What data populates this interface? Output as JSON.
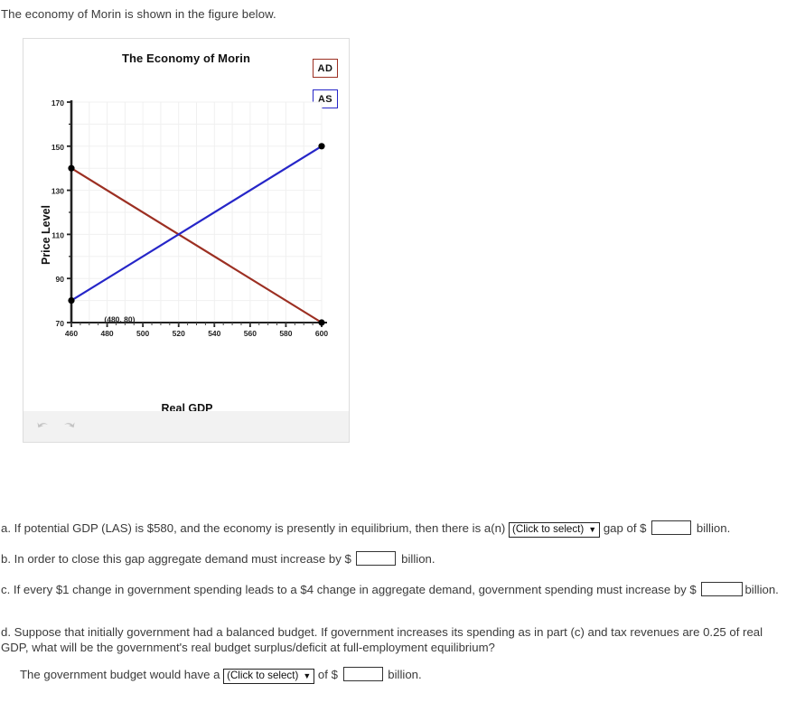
{
  "intro": "The economy of Morin is shown in the figure below.",
  "figure": {
    "legend": [
      {
        "label": "AD",
        "color": "#9c2f22"
      },
      {
        "label": "AS",
        "color": "#2626c8"
      }
    ],
    "toolbar": {
      "undo_icon": "undo-arrow-icon",
      "redo_icon": "redo-arrow-icon"
    }
  },
  "chart_data": {
    "type": "line",
    "title": "The Economy of Morin",
    "xlabel": "Real GDP",
    "ylabel": "Price Level",
    "xlim": [
      460,
      600
    ],
    "ylim": [
      70,
      170
    ],
    "xticks": [
      460,
      480,
      500,
      520,
      540,
      560,
      580,
      600
    ],
    "yticks": [
      70,
      90,
      110,
      130,
      150,
      170
    ],
    "grid": true,
    "legend_position": "top-right",
    "annotations": [
      {
        "text": "(480, 80)",
        "x": 487,
        "y": 71
      }
    ],
    "series": [
      {
        "name": "AD",
        "color": "#9c2f22",
        "points": [
          {
            "x": 460,
            "y": 140
          },
          {
            "x": 600,
            "y": 70
          }
        ],
        "markers": [
          {
            "x": 460,
            "y": 140
          },
          {
            "x": 600,
            "y": 70
          }
        ]
      },
      {
        "name": "AS",
        "color": "#2626c8",
        "points": [
          {
            "x": 460,
            "y": 80
          },
          {
            "x": 600,
            "y": 150
          }
        ],
        "markers": [
          {
            "x": 460,
            "y": 80
          },
          {
            "x": 600,
            "y": 150
          }
        ]
      }
    ]
  },
  "questions": {
    "a": {
      "part1": "a. If potential GDP (LAS) is $580, and the economy is presently in equilibrium, then there is a(n)",
      "select_value": "(Click to select)",
      "part2": "gap of $",
      "part3": "billion."
    },
    "b": {
      "part1": "b. In order to close this gap aggregate demand must increase by $",
      "part2": "billion."
    },
    "c": {
      "part1": "c. If every $1 change in government spending leads to a $4 change in aggregate demand, government spending must increase by $",
      "part2": "billion."
    },
    "d": {
      "part1": "d. Suppose that initially government had a balanced budget. If government increases its spending as in part (c) and tax revenues are 0.25 of real GDP, what will be the government's real budget surplus/deficit at full-employment equilibrium?",
      "sub_part1": "The government budget would have a",
      "select_value": "(Click to select)",
      "sub_part2": "of $",
      "sub_part3": "billion."
    }
  }
}
